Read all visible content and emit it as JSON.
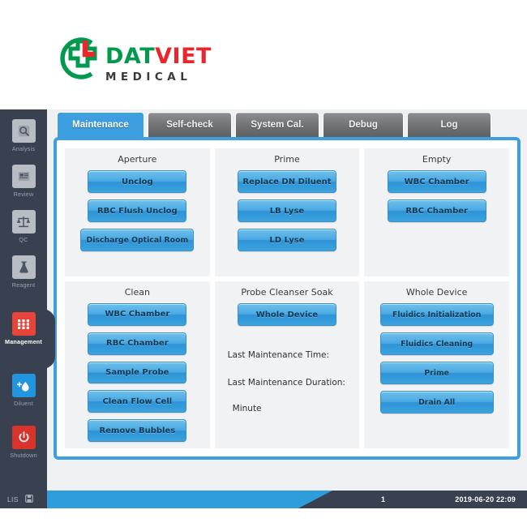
{
  "brand": {
    "name_part1": "DAT",
    "name_part2": "VIET",
    "subtitle": "MEDICAL",
    "green": "#00994d",
    "red": "#e8262c",
    "logo_icon": "cross-with-l-icon"
  },
  "sidebar": {
    "items": [
      {
        "label": "Analysis",
        "icon": "analysis-icon",
        "selected": false
      },
      {
        "label": "Review",
        "icon": "review-icon",
        "selected": false
      },
      {
        "label": "QC",
        "icon": "scales-icon",
        "selected": false
      },
      {
        "label": "Reagent",
        "icon": "flask-icon",
        "selected": false
      },
      {
        "label": "Management",
        "icon": "grid-apps-icon",
        "selected": true
      },
      {
        "label": "Diluent",
        "icon": "water-drop-plus-icon",
        "selected": false
      },
      {
        "label": "Shutdown",
        "icon": "power-icon",
        "selected": false
      }
    ]
  },
  "tabs": [
    {
      "label": "Maintenance",
      "active": true
    },
    {
      "label": "Self-check",
      "active": false
    },
    {
      "label": "System Cal.",
      "active": false
    },
    {
      "label": "Debug",
      "active": false
    },
    {
      "label": "Log",
      "active": false
    }
  ],
  "panels": [
    {
      "title": "Aperture",
      "buttons": [
        "Unclog",
        "RBC Flush Unclog",
        "Discharge Optical Room"
      ]
    },
    {
      "title": "Prime",
      "buttons": [
        "Replace DN Diluent",
        "LB Lyse",
        "LD Lyse"
      ]
    },
    {
      "title": "Empty",
      "buttons": [
        "WBC Chamber",
        "RBC Chamber"
      ]
    },
    {
      "title": "Clean",
      "buttons": [
        "WBC Chamber",
        "RBC Chamber",
        "Sample Probe",
        "Clean Flow Cell",
        "Remove Bubbles"
      ]
    },
    {
      "title": "Probe Cleanser Soak",
      "buttons": [
        "Whole Device"
      ],
      "info": {
        "last_time_label": "Last Maintenance Time:",
        "last_duration_label": "Last Maintenance Duration:",
        "minute_label": "Minute"
      }
    },
    {
      "title": "Whole Device",
      "buttons": [
        "Fluidics Initialization",
        "Fluidics Cleaning",
        "Prime",
        "Drain All"
      ]
    }
  ],
  "statusbar": {
    "left_icon_1": "LIS",
    "left_icon_2": "save-icon",
    "count": "1",
    "timestamp": "2019-06-20 22:09"
  },
  "colors": {
    "accent_blue": "#3d9fe0",
    "button_blue": "#4aa9e2",
    "sidebar_dark": "#39404f",
    "panel_gray": "#f1f2f3",
    "tab_gray": "#74767a",
    "status_blue": "#2f9ddb"
  }
}
